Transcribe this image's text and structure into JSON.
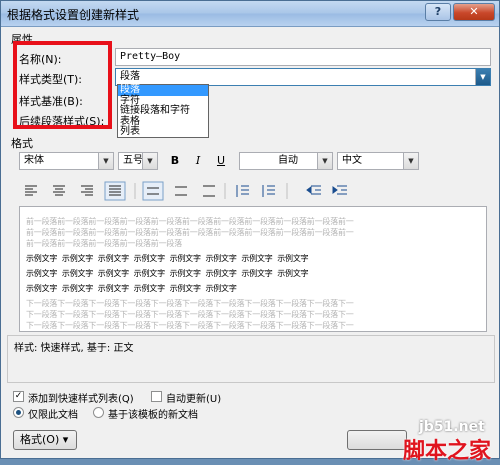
{
  "window": {
    "title": "根据格式设置创建新样式",
    "help": "?",
    "close": "✕"
  },
  "properties": {
    "section": "属性",
    "name_label": "名称(N):",
    "name_value": "Pretty—Boy",
    "style_type_label": "样式类型(T):",
    "style_type_value": "段落",
    "style_base_label": "样式基准(B):",
    "next_style_label": "后续段落样式(S):",
    "dropdown_options": [
      "段落",
      "字符",
      "链接段落和字符",
      "表格",
      "列表"
    ]
  },
  "format": {
    "section": "格式",
    "font": "宋体",
    "size": "五号",
    "bold": "B",
    "italic": "I",
    "underline": "U",
    "color": "自动",
    "script": "中文"
  },
  "preview": {
    "prev_line": "前一段落前一段落前一段落前一段落前一段落前一段落前一段落前一段落前一段落前一段落前一",
    "prev_last": "前一段落前一段落前一段落前一段落前一段落",
    "sample": "示例文字",
    "next_line": "下一段落下一段落下一段落下一段落下一段落下一段落下一段落下一段落下一段落下一段落下一"
  },
  "description": "样式: 快速样式, 基于: 正文",
  "options": {
    "add_quick": "添加到快速样式列表(Q)",
    "auto_update": "自动更新(U)",
    "only_doc": "仅限此文档",
    "template": "基于该模板的新文档"
  },
  "format_button": "格式(O) ▾",
  "watermark": {
    "site": "jb51.net",
    "brand": "脚本之家"
  }
}
